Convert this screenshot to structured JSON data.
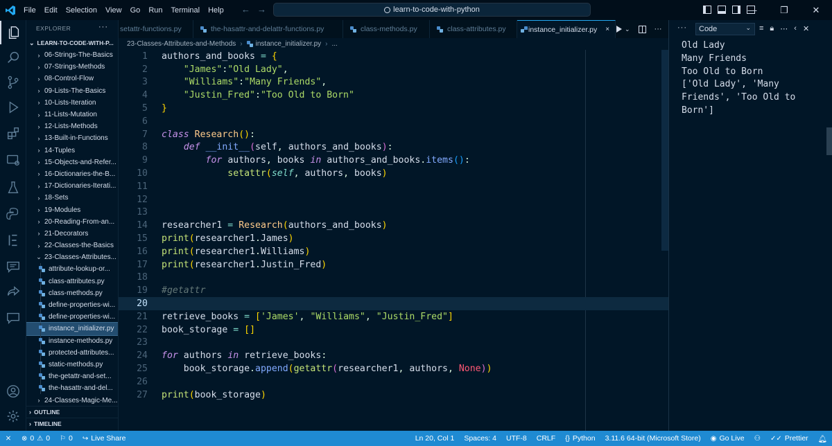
{
  "titlebar": {
    "menu": [
      "File",
      "Edit",
      "Selection",
      "View",
      "Go",
      "Run",
      "Terminal",
      "Help"
    ],
    "search_text": "learn-to-code-with-python",
    "nav_back": "←",
    "nav_forward": "→",
    "min": "—",
    "max": "❐",
    "close": "✕"
  },
  "explorer": {
    "header": "EXPLORER",
    "more": "···",
    "root": "LEARN-TO-CODE-WITH-P...",
    "folders": [
      "06-Strings-The-Basics",
      "07-Strings-Methods",
      "08-Control-Flow",
      "09-Lists-The-Basics",
      "10-Lists-Iteration",
      "11-Lists-Mutation",
      "12-Lists-Methods",
      "13-Built-in-Functions",
      "14-Tuples",
      "15-Objects-and-Refer...",
      "16-Dictionaries-the-B...",
      "17-Dictionaries-Iterati...",
      "18-Sets",
      "19-Modules",
      "20-Reading-From-an...",
      "21-Decorators",
      "22-Classes-the-Basics"
    ],
    "open_folder": "23-Classes-Attributes...",
    "files": [
      "attribute-lookup-or...",
      "class-attributes.py",
      "class-methods.py",
      "define-properties-wi...",
      "define-properties-wi...",
      "instance_initializer.py",
      "instance-methods.py",
      "protected-attributes...",
      "static-methods.py",
      "the-getattr-and-set...",
      "the-hasattr-and-del..."
    ],
    "last_folder": "24-Classes-Magic-Me...",
    "outline": "OUTLINE",
    "timeline": "TIMELINE"
  },
  "tabs": [
    {
      "label": "setattr-functions.py",
      "active": false
    },
    {
      "label": "the-hasattr-and-delattr-functions.py",
      "active": false
    },
    {
      "label": "class-methods.py",
      "active": false
    },
    {
      "label": "class-attributes.py",
      "active": false
    },
    {
      "label": "instance_initializer.py",
      "active": true
    }
  ],
  "tab_close": "×",
  "editor_more": "···",
  "breadcrumb": {
    "folder": "23-Classes-Attributes-and-Methods",
    "file": "instance_initializer.py",
    "tail": "..."
  },
  "editor": {
    "line_numbers": [
      "1",
      "2",
      "3",
      "4",
      "5",
      "6",
      "7",
      "8",
      "9",
      "10",
      "11",
      "12",
      "13",
      "14",
      "15",
      "16",
      "17",
      "18",
      "19",
      "20",
      "21",
      "22",
      "23",
      "24",
      "25",
      "26",
      "27"
    ],
    "current_line": 20
  },
  "output_panel": {
    "more": "···",
    "selected_channel": "Code",
    "output_text": "Old Lady\nMany Friends\nToo Old to Born\n['Old Lady', 'Many\nFriends', 'Too Old to\nBorn']"
  },
  "statusbar": {
    "errors": "0",
    "warnings": "0",
    "ports": "0",
    "live_share": "Live Share",
    "position": "Ln 20, Col 1",
    "spaces": "Spaces: 4",
    "encoding": "UTF-8",
    "eol": "CRLF",
    "language": "Python",
    "interpreter": "3.11.6 64-bit (Microsoft Store)",
    "go_live": "Go Live",
    "prettier": "Prettier"
  },
  "colors": {
    "background": "#011627",
    "statusbar": "#1f8ad2",
    "accent": "#23a9f2"
  }
}
